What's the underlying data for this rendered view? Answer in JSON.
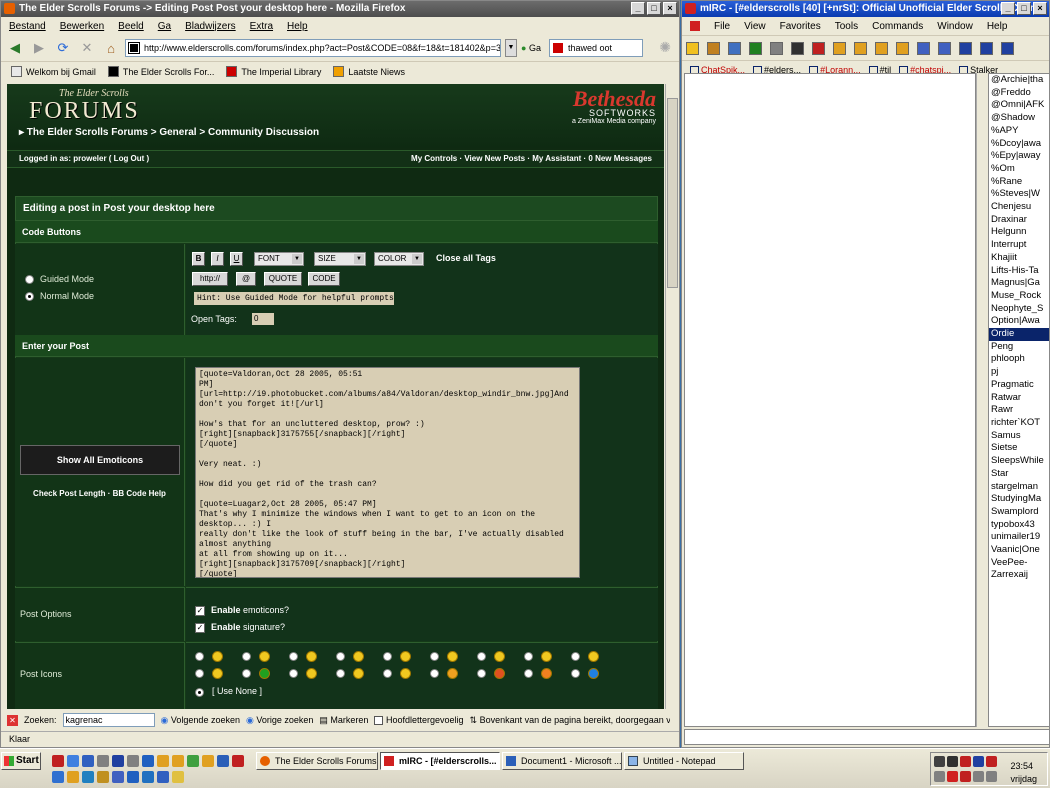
{
  "firefox": {
    "title": "The Elder Scrolls Forums -> Editing Post Post your desktop here - Mozilla Firefox",
    "menu": [
      "Bestand",
      "Bewerken",
      "Beeld",
      "Ga",
      "Bladwijzers",
      "Extra",
      "Help"
    ],
    "url": "http://www.elderscrolls.com/forums/index.php?act=Post&CODE=08&f=18&t=181402&p=3175",
    "go_label": "Ga",
    "search_value": "thawed oot",
    "bookmarks": [
      "Welkom bij Gmail",
      "The Elder Scrolls For...",
      "The Imperial Library",
      "Laatste Niews"
    ],
    "find": {
      "label": "Zoeken:",
      "value": "kagrenac",
      "next": "Volgende zoeken",
      "prev": "Vorige zoeken",
      "highlight": "Markeren",
      "match_case": "Hoofdlettergevoelig",
      "message": "Bovenkant van de pagina bereikt, doorgegaan vanaf"
    },
    "status": "Klaar"
  },
  "forum": {
    "logo_small": "The Elder Scrolls",
    "logo_big": "FORUMS",
    "breadcrumb": "▸ The Elder Scrolls Forums > General > Community Discussion",
    "bethesda": "Bethesda",
    "softworks": "SOFTWORKS",
    "zenimax": "a ZeniMax Media company",
    "logged_in": "Logged in as: proweler ( Log Out )",
    "user_links": "My Controls · View New Posts · My Assistant · 0 New Messages",
    "panel_title": "Editing a post in Post your desktop here",
    "code_buttons": "Code Buttons",
    "guided_mode": "Guided Mode",
    "normal_mode": "Normal Mode",
    "btn_b": "B",
    "btn_i": "I",
    "btn_u": "U",
    "font": "FONT",
    "size": "SIZE",
    "color": "COLOR",
    "close_tags": "Close all Tags",
    "btn_http": "http://",
    "btn_at": "@",
    "btn_quote": "QUOTE",
    "btn_code": "CODE",
    "hint": "Hint: Use Guided Mode for helpful prompts",
    "open_tags_label": "Open Tags:",
    "open_tags_value": "0",
    "enter_post": "Enter your Post",
    "show_emoticons": "Show All Emoticons",
    "check_post": "Check Post Length · BB Code Help",
    "post_text": "[quote=Valdoran,Oct 28 2005, 05:51\nPM][url=http://i9.photobucket.com/albums/a84/Valdoran/desktop_windir_bnw.jpg]And\ndon't you forget it![/url]\n\nHow's that for an uncluttered desktop, prow? :)\n[right][snapback]3175755[/snapback][/right]\n[/quote]\n\nVery neat. :)\n\nHow did you get rid of the trash can?\n\n[quote=Luagar2,Oct 28 2005, 05:47 PM]\nThat's why I minimize the windows when I want to get to an icon on the desktop... :) I\nreally don't like the look of stuff being in the bar, I've actually disabled almost anything\nat all from showing up on it...\n[right][snapback]3175709[/snapback][/right]\n[/quote]\n\nRight side of my screen is taken up by IRC, the other half is this. I'll show you in a\nminute",
    "post_options": "Post Options",
    "enable": "Enable",
    "emoticons_q": "emoticons?",
    "signature_q": "signature?",
    "post_icons": "Post Icons",
    "use_none": "[ Use None ]"
  },
  "mirc": {
    "title": "mIRC - [#elderscrolls [40] [+nrSt]: Official Unofficial Elder Scrolls Chan...",
    "menu": [
      "File",
      "View",
      "Favorites",
      "Tools",
      "Commands",
      "Window",
      "Help"
    ],
    "tabs": [
      "ChatSpik...",
      "#elders...",
      "#Lorann...",
      "#til",
      "#chatspi...",
      "Stalker"
    ],
    "nicks": [
      "@Archie|tha",
      "@Freddo",
      "@Omni|AFK",
      "@Shadow",
      "%APY",
      "%Dcoy|awa",
      "%Epy|away",
      "%Om",
      "%Rane",
      "%Steves|W",
      "Chenjesu",
      "Draxinar",
      "Helgunn",
      "Interrupt",
      "Khajiit",
      "Lifts-His-Ta",
      "Magnus|Ga",
      "Muse_Rock",
      "Neophyte_S",
      "Option|Awa",
      "Ordie",
      "Peng",
      "phlooph",
      "pj",
      "Pragmatic",
      "Ratwar",
      "Rawr",
      "richter`KOT",
      "Samus",
      "Sietse",
      "SleepsWhile",
      "Star",
      "stargelman",
      "StudyingMa",
      "Swamplord",
      "typobox43",
      "unimailer19",
      "Vaanic|One",
      "VeePee-",
      "Zarrexaij"
    ],
    "selected_nick": "Ordie"
  },
  "taskbar": {
    "start": "Start",
    "tasks": [
      "The Elder Scrolls Forums ...",
      "mIRC - [#elderscrolls...",
      "Document1 - Microsoft ...",
      "Untitled - Notepad"
    ],
    "time": "23:54",
    "day": "vrijdag"
  },
  "colors": {
    "forum_bg": "#0f2a12",
    "bethesda_red": "#d9382e",
    "mirc_selection": "#0a246a"
  }
}
